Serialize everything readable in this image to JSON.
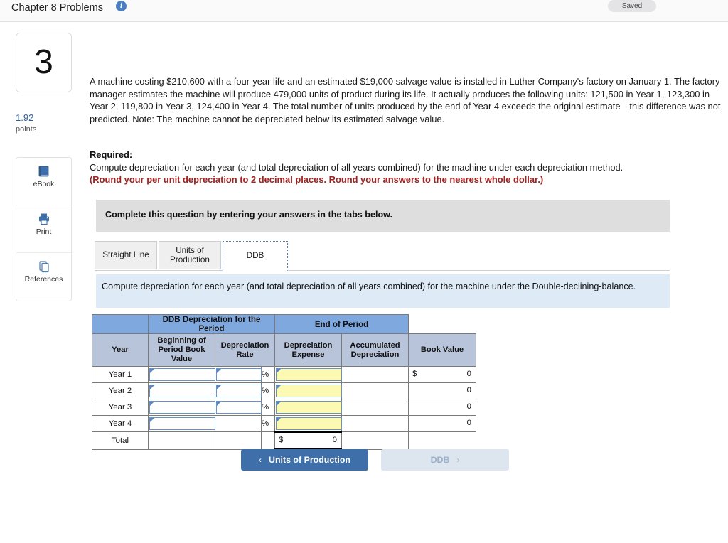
{
  "topbar": {
    "title": "Chapter 8 Problems",
    "info_icon": "info-icon",
    "saved_label": "Saved"
  },
  "sidebar": {
    "question_number": "3",
    "points_value": "1.92",
    "points_label": "points",
    "tools": [
      {
        "label": "eBook",
        "icon": "book-icon"
      },
      {
        "label": "Print",
        "icon": "printer-icon"
      },
      {
        "label": "References",
        "icon": "copy-pages-icon"
      }
    ]
  },
  "question": {
    "body": "A machine costing $210,600 with a four-year life and an estimated $19,000 salvage value is installed in Luther Company's factory on January 1. The factory manager estimates the machine will produce 479,000 units of product during its life. It actually produces the following units: 121,500 in Year 1, 123,300 in Year 2, 119,800 in Year 3, 124,400 in Year 4. The total number of units produced by the end of Year 4 exceeds the original estimate—this difference was not predicted. Note: The machine cannot be depreciated below its estimated salvage value.",
    "required_heading": "Required:",
    "required_text": "Compute depreciation for each year (and total depreciation of all years combined) for the machine under each depreciation method.",
    "required_note": "(Round your per unit depreciation to 2 decimal places. Round your answers to the nearest whole dollar.)"
  },
  "instruction_panel": {
    "text": "Complete this question by entering your answers in the tabs below."
  },
  "tabs": [
    {
      "label": "Straight Line",
      "active": false
    },
    {
      "label": "Units of Production",
      "active": false
    },
    {
      "label": "DDB",
      "active": true
    }
  ],
  "tab_panel": {
    "text": "Compute depreciation for each year (and total depreciation of all years combined) for the machine under the Double-declining-balance."
  },
  "table": {
    "group_headers": [
      "",
      "DDB Depreciation for the Period",
      "End of Period"
    ],
    "columns": [
      "Year",
      "Beginning of Period Book Value",
      "Depreciation Rate",
      "Depreciation Expense",
      "Accumulated Depreciation",
      "Book Value"
    ],
    "percent_symbol": "%",
    "dollar_symbol": "$",
    "rows": [
      {
        "year": "Year 1",
        "beginning_book_value": "",
        "depreciation_rate": "",
        "depreciation_expense": "",
        "accumulated_depreciation": "",
        "book_value_dollar": "$",
        "book_value": "0"
      },
      {
        "year": "Year 2",
        "beginning_book_value": "",
        "depreciation_rate": "",
        "depreciation_expense": "",
        "accumulated_depreciation": "",
        "book_value_dollar": "",
        "book_value": "0"
      },
      {
        "year": "Year 3",
        "beginning_book_value": "",
        "depreciation_rate": "",
        "depreciation_expense": "",
        "accumulated_depreciation": "",
        "book_value_dollar": "",
        "book_value": "0"
      },
      {
        "year": "Year 4",
        "beginning_book_value": "",
        "depreciation_rate": "",
        "depreciation_expense": "",
        "accumulated_depreciation": "",
        "book_value_dollar": "",
        "book_value": "0"
      }
    ],
    "total_row": {
      "label": "Total",
      "expense_dollar": "$",
      "expense_value": "0"
    }
  },
  "navigation": {
    "prev_label": "Units of Production",
    "prev_chevron": "‹",
    "next_label": "DDB",
    "next_chevron": "›"
  },
  "colors": {
    "header_blue": "#7fa9de",
    "subheader_blue": "#b8c4da",
    "input_yellow": "#fbf9b2",
    "panel_blue": "#dfeaf7",
    "panel_gray": "#dedede",
    "accent_red": "#a32020",
    "nav_active": "#3f6fa8",
    "nav_disabled": "#dde5ef"
  }
}
